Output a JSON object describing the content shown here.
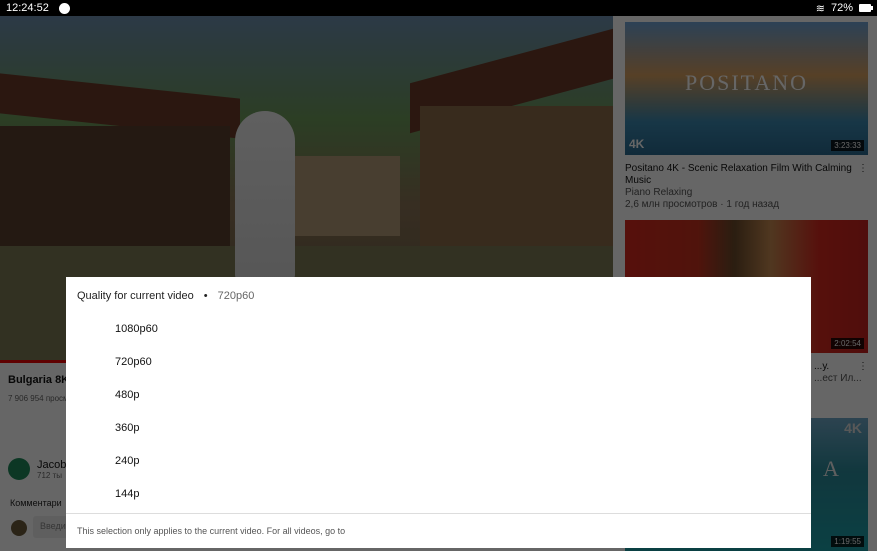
{
  "status_bar": {
    "time": "12:24:52",
    "battery": "72%"
  },
  "video": {
    "title": "Bulgaria 8K",
    "views": "7 906 954 просм",
    "progress_fraction": 0.0
  },
  "channel": {
    "name": "Jacob",
    "subscribers": "712 ты"
  },
  "comments": {
    "label": "Комментари",
    "input_placeholder": "Введи"
  },
  "sidebar": [
    {
      "title": "Positano 4K - Scenic Relaxation Film With Calming Music",
      "channel": "Piano Relaxing",
      "meta": "2,6 млн просмотров · 1 год назад",
      "duration": "3:23:33",
      "thumb_text": "POSITANO",
      "badge": "4K"
    },
    {
      "title": "...у.",
      "meta": "...ест Ил...",
      "duration": "2:02:54"
    },
    {
      "duration": "1:19:55",
      "badge": "4K",
      "thumb_text": "A"
    }
  ],
  "quality_sheet": {
    "header": "Quality for current video",
    "separator": "•",
    "current": "720p60",
    "options": [
      "1080p60",
      "720p60",
      "480p",
      "360p",
      "240p",
      "144p"
    ],
    "footer": "This selection only applies to the current video. For all videos, go to"
  }
}
